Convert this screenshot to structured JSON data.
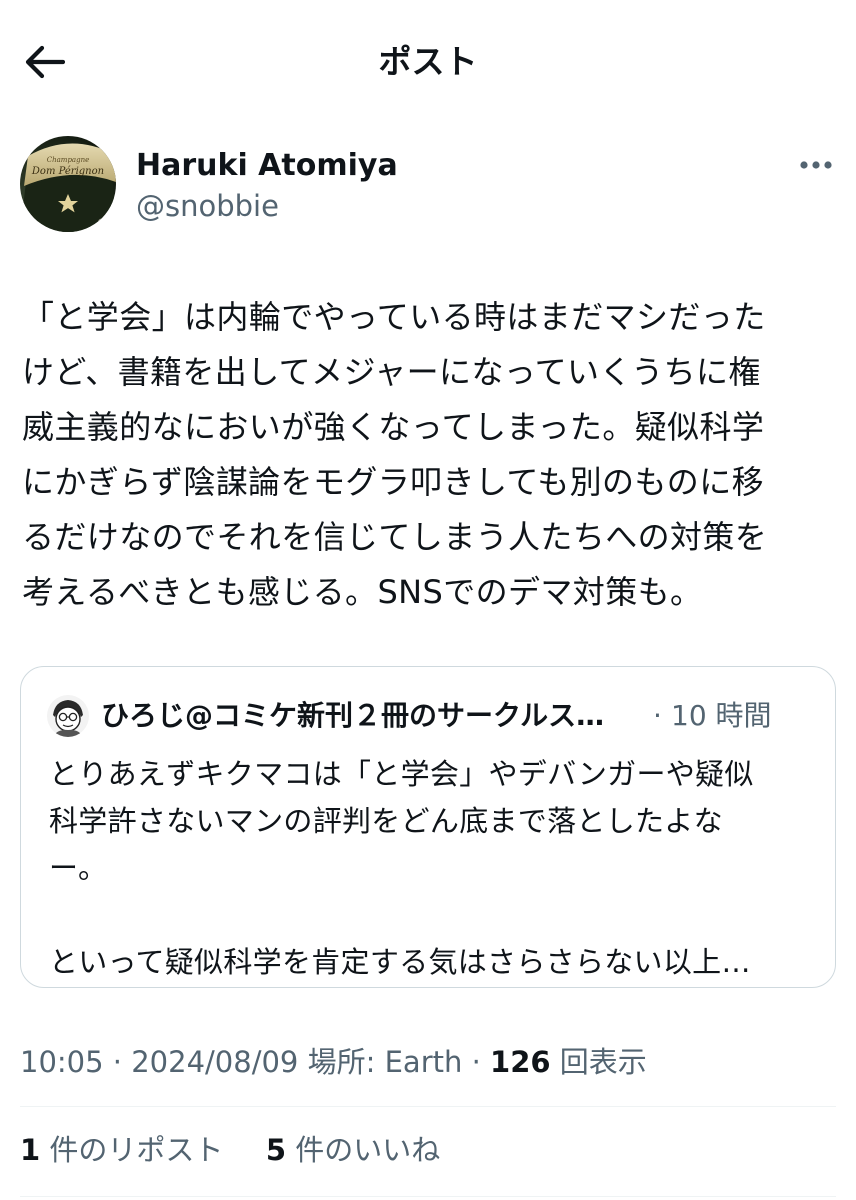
{
  "header": {
    "title": "ポスト",
    "back_icon": "arrow-left-icon"
  },
  "author": {
    "name": "Haruki Atomiya",
    "handle": "@snobbie",
    "avatar": "champagne-bottle-photo",
    "avatar_label": "Dom Pérignon"
  },
  "tweet": {
    "lines": [
      "「と学会」は内輪でやっている時はまだマシだった",
      "けど、書籍を出してメジャーになっていくうちに権",
      "威主義的なにおいが強くなってしまった。疑似科学",
      "にかぎらず陰謀論をモグラ叩きしても別のものに移",
      "るだけなのでそれを信じてしまう人たちへの対策を",
      "考えるべきとも感じる。SNSでのデマ対策も。"
    ]
  },
  "quote": {
    "name": "ひろじ@コミケ新刊２冊のサークルス…",
    "dot": "·",
    "time": "10 時間",
    "lines": [
      "とりあえずキクマコは「と学会」やデバンガーや疑似",
      "科学許さないマンの評判をどん底まで落としたよな",
      "ー。",
      "",
      "といって疑似科学を肯定する気はさらさらない以上…"
    ]
  },
  "meta": {
    "time": "10:05",
    "sep1": " · ",
    "date": "2024/08/09",
    "location": " 場所: Earth",
    "sep2": " · ",
    "views_count": "126",
    "views_label": " 回表示"
  },
  "stats": {
    "reposts_count": "1",
    "reposts_label": " 件のリポスト",
    "likes_count": "5",
    "likes_label": " 件のいいね"
  },
  "colors": {
    "text": "#0f1419",
    "secondary": "#536471",
    "border": "#cfd9de",
    "divider": "#eff3f4"
  }
}
